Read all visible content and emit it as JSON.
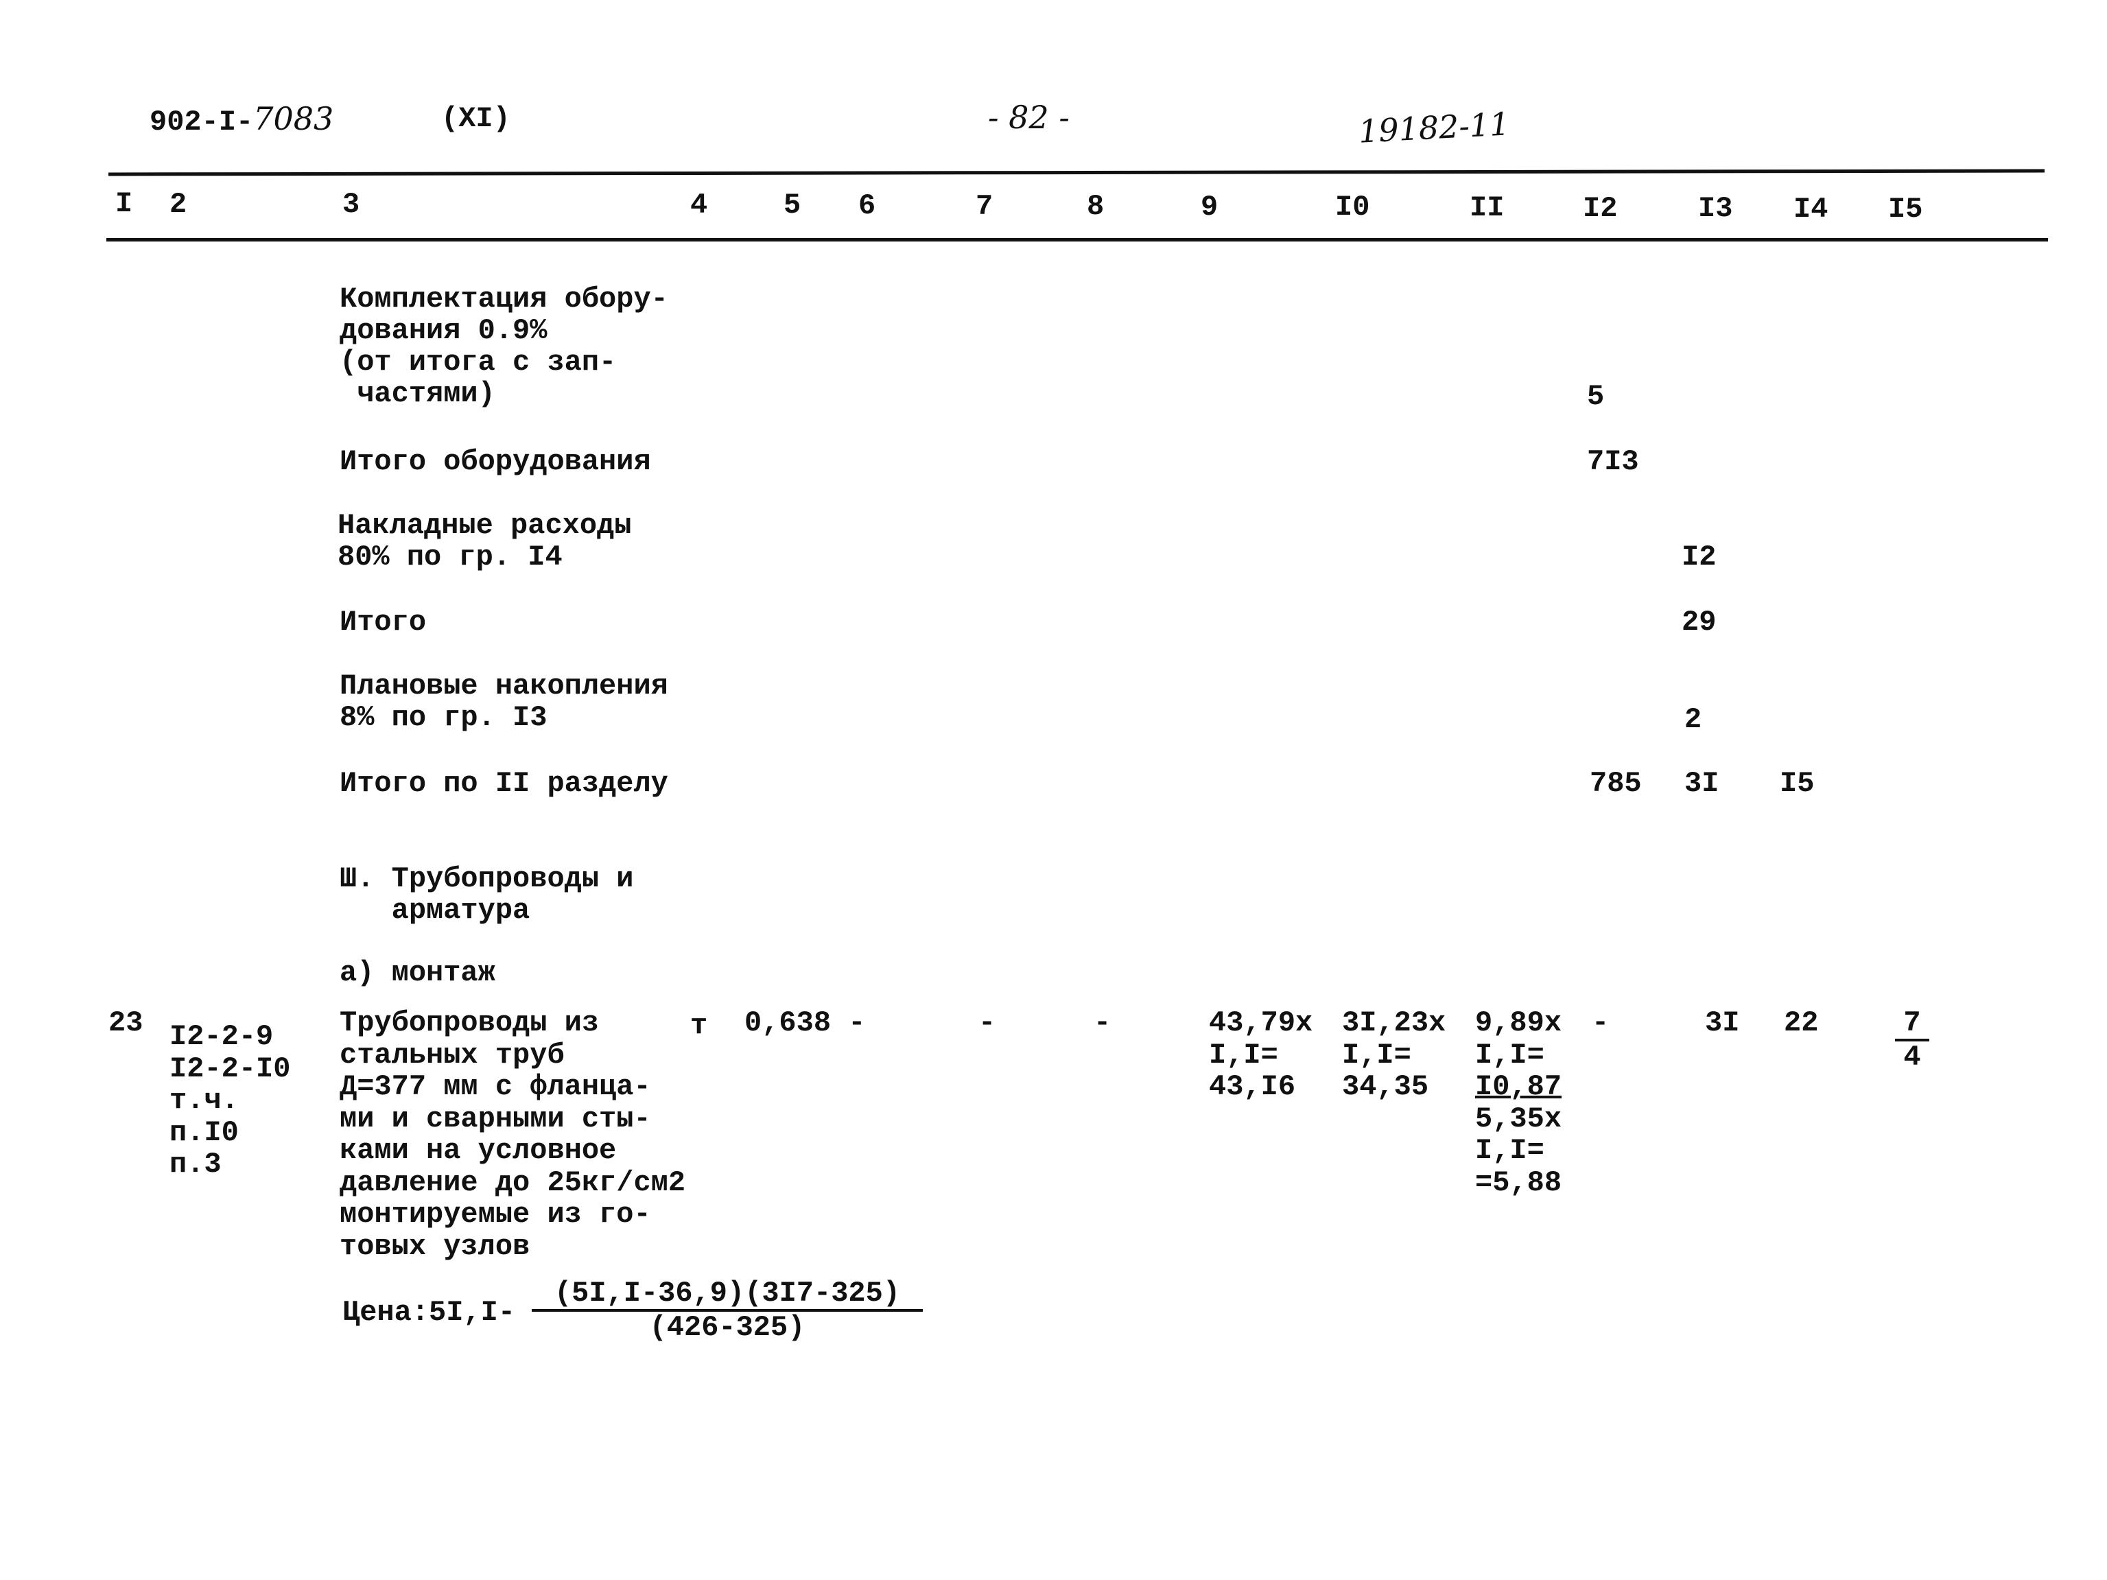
{
  "header": {
    "doc_code_printed": "902-I-",
    "doc_code_handwritten": "7083",
    "volume": "(XI)",
    "page_number": "- 82 -",
    "handwritten_number": "19182-11"
  },
  "columns": [
    "I",
    "2",
    "3",
    "4",
    "5",
    "6",
    "7",
    "8",
    "9",
    "I0",
    "II",
    "I2",
    "I3",
    "I4",
    "I5"
  ],
  "summary_rows": [
    {
      "text": "Комплектация обору-\nдования 0.9%\n(от итога с зап-\n частями)",
      "c12": "5"
    },
    {
      "text": "Итого оборудования",
      "c12": "7I3"
    },
    {
      "text": "Накладные расходы\n80% по гр. I4",
      "c13": "I2"
    },
    {
      "text": "Итого",
      "c13": "29"
    },
    {
      "text": "Плановые накопления\n8% по гр. I3",
      "c13": "2"
    },
    {
      "text": "Итого по II разделу",
      "c12": "785",
      "c13": "3I",
      "c14": "I5"
    }
  ],
  "section": {
    "title": "Ш. Трубопроводы и\n   арматура",
    "subsection": "а) монтаж"
  },
  "item": {
    "no": "23",
    "code": "I2-2-9\nI2-2-I0\nт.ч.\nп.I0\nп.3",
    "description": "Трубопроводы из\nстальных труб\nД=377 мм с фланца-\nми и сварными сты-\nками на условное\nдавление до 25кг/см2\nмонтируемые из го-\nтовых узлов",
    "unit": "т",
    "qty": "0,638 -",
    "c7": "-",
    "c8": "-",
    "c9": "43,79x\nI,I=\n43,I6",
    "c10": "3I,23x\nI,I=\n34,35",
    "c11_top": "9,89x\nI,I=",
    "c11_underlined": "I0,87",
    "c11_bottom": "5,35x\nI,I=\n=5,88",
    "c12": "-",
    "c13": "3I",
    "c14": "22",
    "c15_num": "7",
    "c15_den": "4",
    "price_label": "Цена:5I,I-",
    "price_numerator": "(5I,I-36,9)(3I7-325)",
    "price_denominator": "(426-325)"
  }
}
